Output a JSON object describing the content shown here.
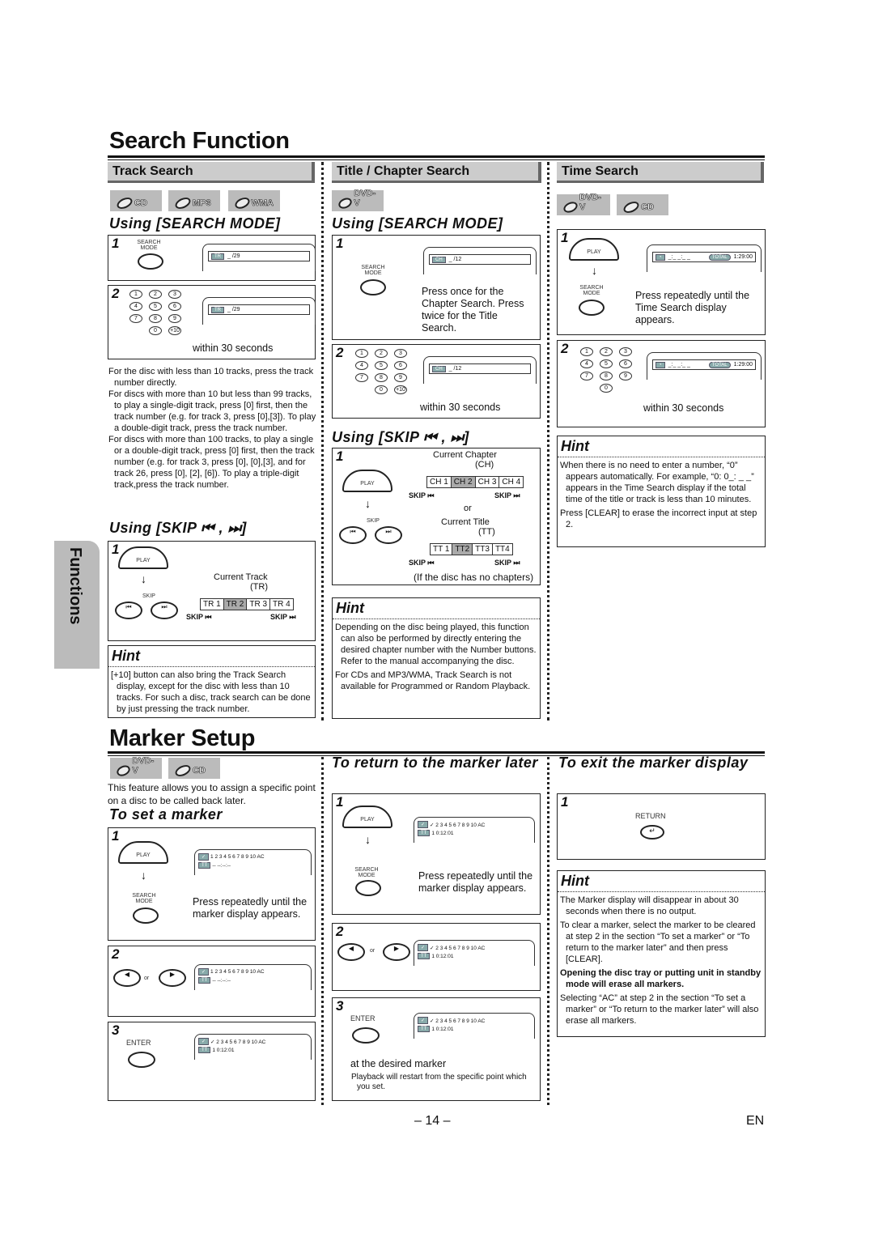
{
  "page": {
    "number_label": "– 14 –",
    "lang": "EN",
    "side_tab": "Functions"
  },
  "search": {
    "title": "Search Function",
    "track": {
      "header": "Track Search",
      "badges": [
        "CD",
        "MP3",
        "WMA"
      ],
      "mode_title": "Using [SEARCH MODE]",
      "step1": {
        "num": "1",
        "button": "SEARCH MODE",
        "display_chip": "TR",
        "display_val": "_ /29"
      },
      "step2": {
        "num": "2",
        "display_chip": "TR",
        "display_val": "_ /29",
        "note": "within 30 seconds",
        "keys": [
          "1",
          "2",
          "3",
          "4",
          "5",
          "6",
          "7",
          "8",
          "9",
          "0",
          "+10"
        ]
      },
      "bullets": [
        "For the disc with less than 10 tracks, press the track number directly.",
        "For discs with more than 10 but less than 99 tracks, to play a single-digit track, press [0] first, then the track number (e.g. for track 3, press [0],[3]). To play a double-digit track, press the track number.",
        "For discs with more than 100 tracks, to play a single or a double-digit track, press [0] first, then the track number (e.g. for track 3, press [0], [0],[3], and for track 26, press [0], [2], [6]). To play a triple-digit track,press the track number."
      ],
      "skip_title": "Using [SKIP ⏮ , ⏭]",
      "skip": {
        "num": "1",
        "play": "PLAY",
        "skip": "SKIP",
        "current_label": "Current Track",
        "abbr": "(TR)",
        "cells": [
          "TR 1",
          "TR 2",
          "TR 3",
          "TR 4"
        ],
        "current_index": 1,
        "left": "SKIP ⏮",
        "right": "SKIP ⏭"
      },
      "hint_title": "Hint",
      "hint": "[+10] button can also bring the Track Search display, except for the disc with less than 10 tracks.  For such a disc, track search can be done by just pressing the track number."
    },
    "chapter": {
      "header": "Title / Chapter Search",
      "badges": [
        "DVD-V"
      ],
      "mode_title": "Using [SEARCH MODE]",
      "step1": {
        "num": "1",
        "button": "SEARCH MODE",
        "display_chip": "CH",
        "display_val": "_ /12",
        "text": "Press once for the Chapter Search. Press twice for the Title Search."
      },
      "step2": {
        "num": "2",
        "display_chip": "CH",
        "display_val": "_ /12",
        "note": "within 30 seconds"
      },
      "skip_title": "Using [SKIP ⏮ , ⏭]",
      "skip": {
        "num": "1",
        "play": "PLAY",
        "skip": "SKIP",
        "ch_label": "Current Chapter",
        "ch_abbr": "(CH)",
        "ch_cells": [
          "CH 1",
          "CH 2",
          "CH 3",
          "CH 4"
        ],
        "or": "or",
        "tt_label": "Current Title",
        "tt_abbr": "(TT)",
        "tt_cells": [
          "TT 1",
          "TT2",
          "TT3",
          "TT4"
        ],
        "left": "SKIP ⏮",
        "right": "SKIP ⏭",
        "note": "(If the disc has no chapters)"
      },
      "hint_title": "Hint",
      "hints": [
        "Depending on the disc being played, this function can also be performed by directly entering the desired chapter number with the Number buttons. Refer to the manual accompanying the disc.",
        "For CDs and MP3/WMA, Track Search is not available for Programmed or Random Playback."
      ]
    },
    "time": {
      "header": "Time Search",
      "badges": [
        "DVD-V",
        "CD"
      ],
      "step1": {
        "num": "1",
        "play": "PLAY",
        "button": "SEARCH MODE",
        "display_val": "_:_ _:_ _",
        "total_chip": "TOTAL",
        "total": "1:29:00",
        "text": "Press repeatedly until the Time Search display appears."
      },
      "step2": {
        "num": "2",
        "display_val": "_:_ _:_ _",
        "total_chip": "TOTAL",
        "total": "1:29:00",
        "note": "within 30 seconds"
      },
      "hint_title": "Hint",
      "hints": [
        "When there is no need to enter a number, “0” appears automatically. For example, “0: 0_: _ _” appears in the Time Search display if the total time of the title or track is less than 10 minutes.",
        "Press [CLEAR] to erase the incorrect input at step 2."
      ]
    }
  },
  "marker": {
    "title": "Marker Setup",
    "badges": [
      "DVD-V",
      "CD"
    ],
    "intro": "This feature allows you to assign a specific point on a disc to be called back later.",
    "set": {
      "title": "To set a marker",
      "step1": {
        "num": "1",
        "play": "PLAY",
        "button": "SEARCH MODE",
        "text": "Press repeatedly until the marker display appears.",
        "row1": "1 2 3 4 5 6 7 8 9 10 AC",
        "row2": "-- --:--:--"
      },
      "step2": {
        "num": "2",
        "or": "or",
        "row1": "1 2 3 4 5 6 7 8 9 10 AC",
        "row2": "-- --:--:--"
      },
      "step3": {
        "num": "3",
        "button": "ENTER",
        "row1": "✓ 2 3 4 5 6 7 8 9 10 AC",
        "row2": "1  0:12:01"
      }
    },
    "return": {
      "title": "To return to the marker later",
      "step1": {
        "num": "1",
        "play": "PLAY",
        "button": "SEARCH MODE",
        "text": "Press repeatedly until the marker display appears.",
        "row1": "✓ 2 3 4 5 6 7 8 9 10 AC",
        "row2": "1  0:12:01"
      },
      "step2": {
        "num": "2",
        "or": "or",
        "row1": "✓ 2 3 4 5 6 7 8 9 10 AC",
        "row2": "1  0:12:01"
      },
      "step3": {
        "num": "3",
        "button": "ENTER",
        "row1": "✓ 2 3 4 5 6 7 8 9 10 AC",
        "row2": "1  0:12:01",
        "text": "at the desired marker",
        "bullet": "Playback will restart from the specific point which you set."
      }
    },
    "exit": {
      "title": "To exit the marker display",
      "step1": {
        "num": "1",
        "button": "RETURN"
      },
      "hint_title": "Hint",
      "hints": [
        "The Marker display will disappear in about 30 seconds when there is no output.",
        "To clear a marker, select the marker to be cleared at step 2 in the section “To set a marker” or “To return to the marker later” and then press [CLEAR].",
        "Opening the disc tray or putting unit in standby mode will erase all markers.",
        "Selecting “AC” at step 2 in the section “To set a marker” or “To return to the marker later” will also erase all markers."
      ]
    }
  }
}
